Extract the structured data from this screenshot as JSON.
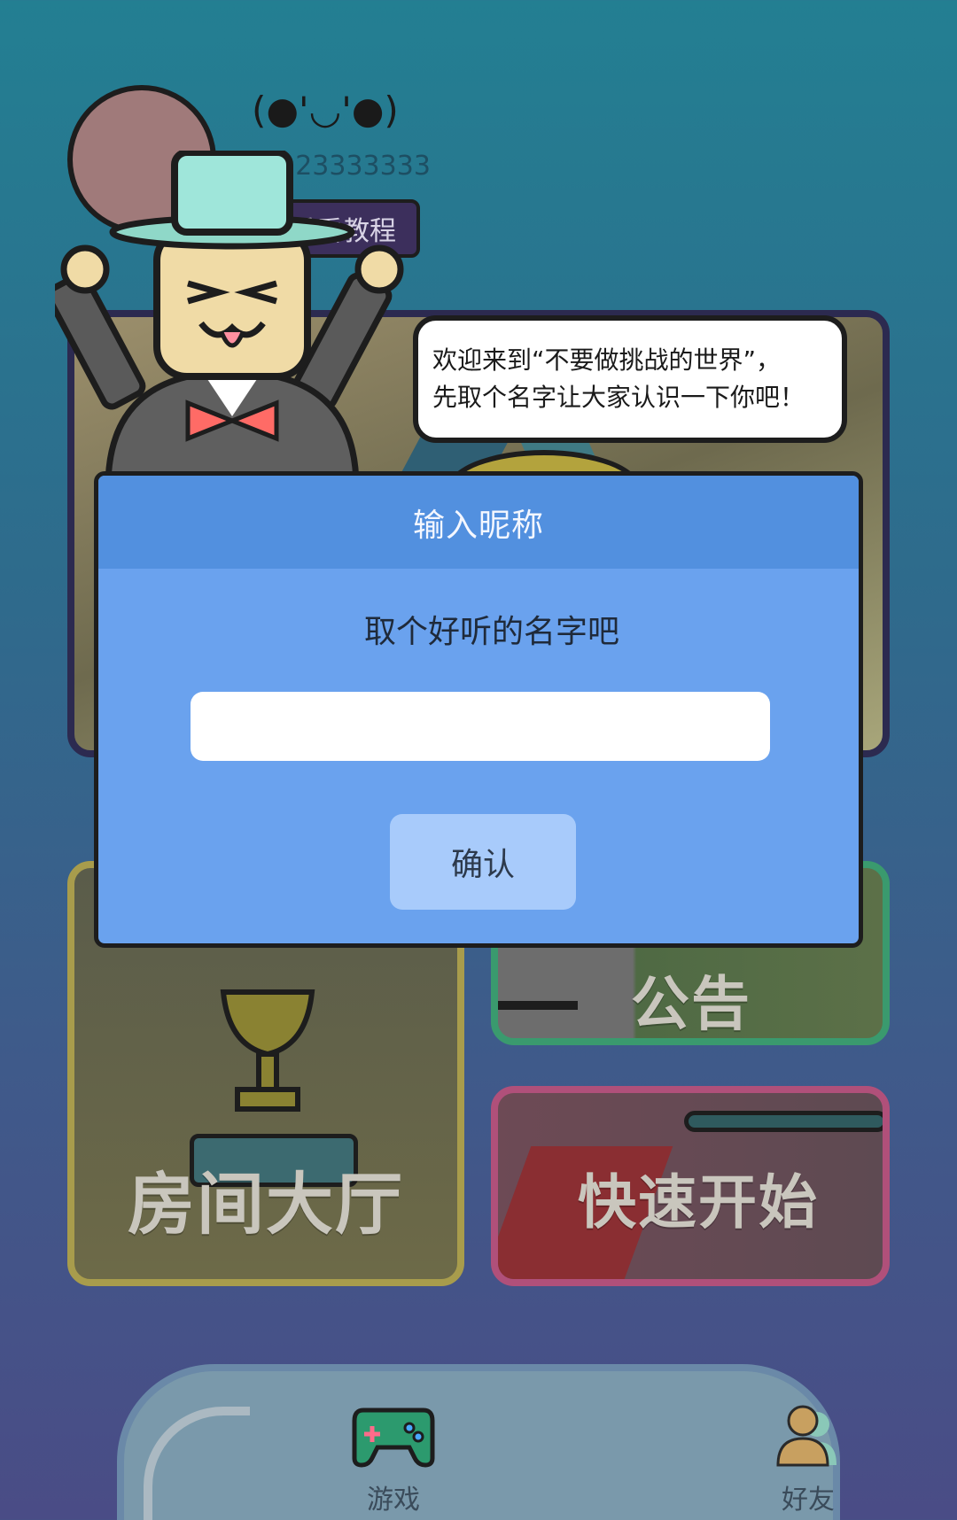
{
  "profile": {
    "emoticon": "(●'◡'●)",
    "uid": "D:23333333",
    "tutorial_button": "重看教程"
  },
  "speech_bubble": {
    "line1": "欢迎来到“不要做挑战的世界”，",
    "line2": "先取个名字让大家认识一下你吧！"
  },
  "dialog": {
    "title": "输入昵称",
    "prompt": "取个好听的名字吧",
    "input_value": "",
    "input_placeholder": "",
    "confirm_label": "确认"
  },
  "cards": {
    "lobby": "房间大厅",
    "notice": "公告",
    "quick_start": "快速开始"
  },
  "tabs": [
    {
      "label": "游戏",
      "icon": "gamepad-icon"
    },
    {
      "label": "好友",
      "icon": "friends-icon"
    }
  ],
  "colors": {
    "modal_header": "#5290df",
    "modal_body": "#6aa2ee",
    "confirm_button": "#a8cbfb"
  }
}
